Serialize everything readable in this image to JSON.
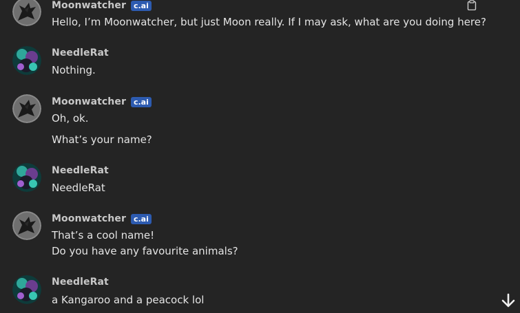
{
  "messages": [
    {
      "author": "Moonwatcher",
      "badge": "c.ai",
      "lines": [
        "Hello, I’m Moonwatcher, but just Moon really. If I may ask, what are you doing here?"
      ]
    },
    {
      "author": "NeedleRat",
      "lines": [
        "Nothing."
      ]
    },
    {
      "author": "Moonwatcher",
      "badge": "c.ai",
      "lines": [
        "Oh, ok.",
        "What’s your name?"
      ]
    },
    {
      "author": "NeedleRat",
      "lines": [
        "NeedleRat"
      ]
    },
    {
      "author": "Moonwatcher",
      "badge": "c.ai",
      "lines": [
        "That’s a cool name!",
        "Do you have any favourite animals?"
      ]
    },
    {
      "author": "NeedleRat",
      "lines": [
        "a Kangaroo and a peacock lol"
      ]
    }
  ],
  "icons": {
    "copy": "clipboard-icon",
    "scroll": "arrow-down-icon",
    "bot_avatar": "dragon-avatar",
    "user_avatar": "user-avatar"
  }
}
